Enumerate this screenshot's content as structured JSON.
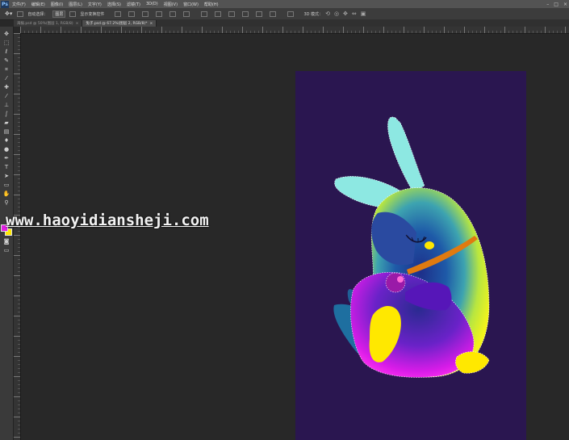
{
  "app": {
    "logo": "Ps"
  },
  "menu": [
    "文件(F)",
    "编辑(E)",
    "图像(I)",
    "图层(L)",
    "文字(Y)",
    "选择(S)",
    "滤镜(T)",
    "3D(D)",
    "视图(V)",
    "窗口(W)",
    "帮助(H)"
  ],
  "window_controls": [
    "–",
    "□",
    "×"
  ],
  "options_bar": {
    "auto_select_label": "自动选择：",
    "auto_select_value": "图层",
    "transform_label": "显示变换控件",
    "mode_3d_label": "3D 模式："
  },
  "tabs": [
    {
      "label": "海报.psd @ 50%(图层 1, RGB/8)",
      "close": "×"
    },
    {
      "label": "兔子.psd @ 67.2%(图层 2, RGB/8)*",
      "close": "×"
    }
  ],
  "watermark": "www.haoyidiansheji.com",
  "colors": {
    "canvas_bg": "#2a1650",
    "ear": "#8de8e2",
    "foreground_swatch": "#e020e0",
    "background_swatch": "#ffe800",
    "collar": "#e07a10"
  },
  "icons": [
    "move-icon",
    "marquee-icon",
    "lasso-icon",
    "quick-select-icon",
    "crop-icon",
    "eyedropper-icon",
    "healing-icon",
    "brush-icon",
    "stamp-icon",
    "history-brush-icon",
    "eraser-icon",
    "gradient-icon",
    "blur-icon",
    "dodge-icon",
    "pen-icon",
    "type-icon",
    "path-select-icon",
    "shape-icon",
    "hand-icon",
    "zoom-icon"
  ]
}
